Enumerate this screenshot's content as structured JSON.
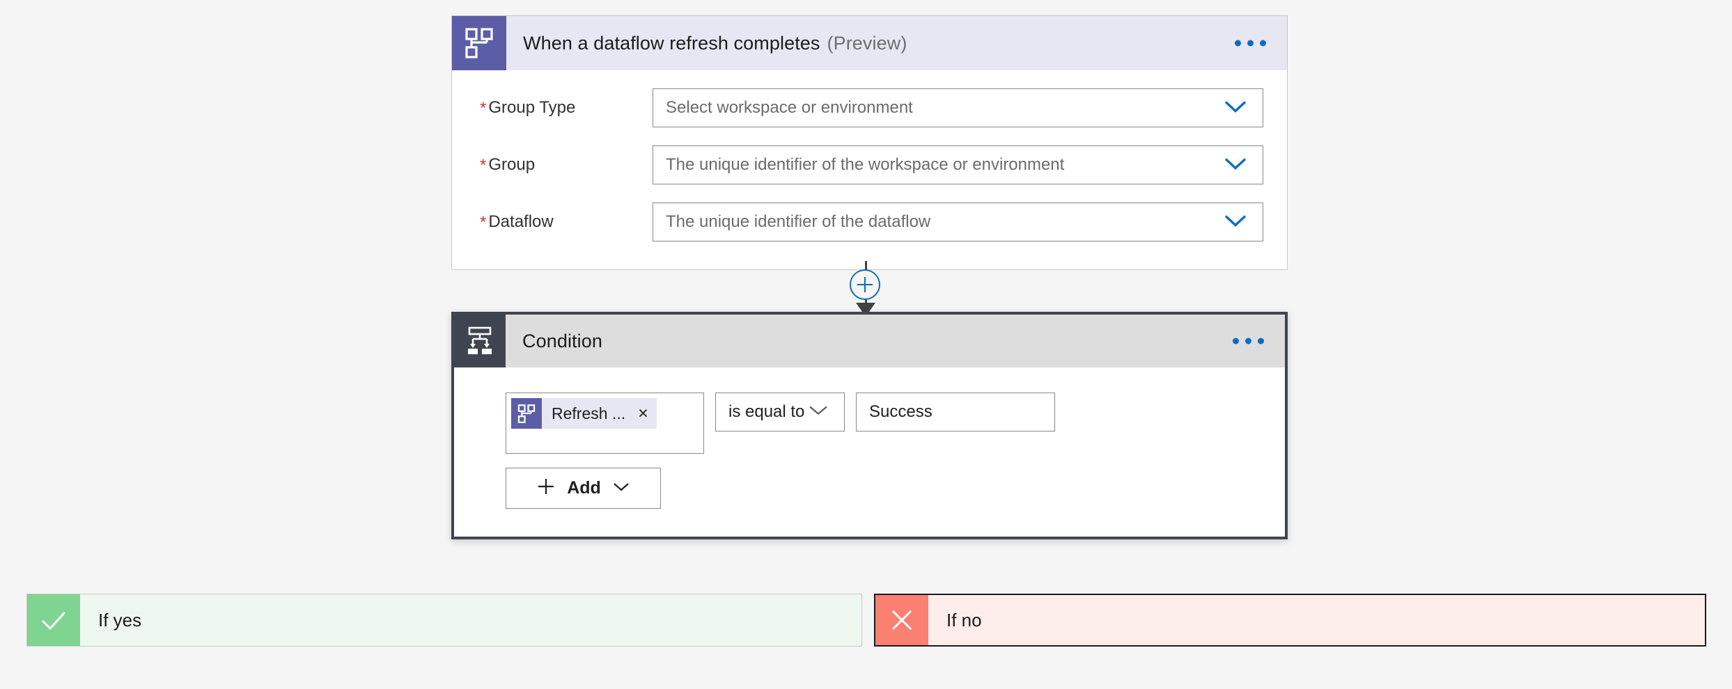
{
  "colors": {
    "background": "#f5f5f5",
    "trigger_accent": "#5b5ea6",
    "trigger_header": "#e7e6f3",
    "condition_accent": "#3f4550",
    "condition_header": "#dddddd",
    "link_blue": "#0f6cbd",
    "required_red": "#d13438",
    "yes_green": "#7ed490",
    "no_red": "#fa8072"
  },
  "trigger": {
    "icon": "dataflow-icon",
    "title": "When a dataflow refresh completes",
    "title_suffix": "(Preview)",
    "menu_icon": "ellipsis-icon",
    "fields": [
      {
        "label": "Group Type",
        "required": "*",
        "placeholder": "Select workspace or environment",
        "dropdown_icon": "chevron-down-icon"
      },
      {
        "label": "Group",
        "required": "*",
        "placeholder": "The unique identifier of the workspace or environment",
        "dropdown_icon": "chevron-down-icon"
      },
      {
        "label": "Dataflow",
        "required": "*",
        "placeholder": "The unique identifier of the dataflow",
        "dropdown_icon": "chevron-down-icon"
      }
    ]
  },
  "connector": {
    "add_icon": "plus-circle-icon",
    "arrow_icon": "arrow-down-icon"
  },
  "condition": {
    "icon": "condition-branch-icon",
    "title": "Condition",
    "menu_icon": "ellipsis-icon",
    "row": {
      "token": {
        "icon": "dataflow-icon",
        "label": "Refresh ...",
        "remove_icon": "close-icon",
        "remove_label": "×"
      },
      "operator": {
        "value": "is equal to",
        "dropdown_icon": "chevron-down-icon"
      },
      "value": "Success"
    },
    "add_button": {
      "plus_icon": "plus-icon",
      "label": "Add",
      "dropdown_icon": "chevron-down-icon"
    }
  },
  "branches": [
    {
      "icon": "check-icon",
      "label": "If yes"
    },
    {
      "icon": "cross-icon",
      "label": "If no"
    }
  ]
}
